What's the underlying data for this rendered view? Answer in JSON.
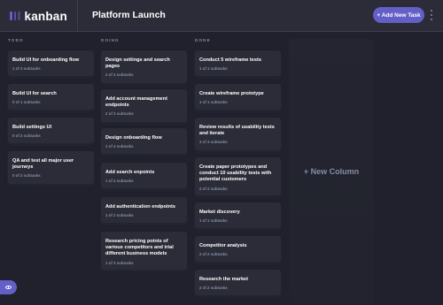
{
  "app": {
    "name": "kanban"
  },
  "header": {
    "board_title": "Platform Launch",
    "add_task_label": "+ Add New Task"
  },
  "columns": [
    {
      "name": "TODO",
      "tasks": [
        {
          "title": "Build UI for onboarding flow",
          "subtasks": "1 of 3 subtasks"
        },
        {
          "title": "Build UI for search",
          "subtasks": "0 of 1 subtasks"
        },
        {
          "title": "Build settings UI",
          "subtasks": "0 of 2 subtasks"
        },
        {
          "title": "QA and test all major user journeys",
          "subtasks": "0 of 2 subtasks"
        }
      ]
    },
    {
      "name": "DOING",
      "tasks": [
        {
          "title": "Design settings and search pages",
          "subtasks": "2 of 3 subtasks"
        },
        {
          "title": "Add account management endpoints",
          "subtasks": "2 of 3 subtasks"
        },
        {
          "title": "Design onboarding flow",
          "subtasks": "1 of 3 subtasks"
        },
        {
          "title": "Add search enpoints",
          "subtasks": "1 of 2 subtasks"
        },
        {
          "title": "Add authentication endpoints",
          "subtasks": "1 of 2 subtasks"
        },
        {
          "title": "Research pricing points of various competitors and trial different business models",
          "subtasks": "1 of 3 subtasks"
        }
      ]
    },
    {
      "name": "DONE",
      "tasks": [
        {
          "title": "Conduct 5 wireframe tests",
          "subtasks": "1 of 1 subtasks"
        },
        {
          "title": "Create wireframe prototype",
          "subtasks": "1 of 1 subtasks"
        },
        {
          "title": "Review results of usability tests and iterate",
          "subtasks": "3 of 3 subtasks"
        },
        {
          "title": "Create paper prototypes and conduct 10 usability tests with potential customers",
          "subtasks": "2 of 2 subtasks"
        },
        {
          "title": "Market discovery",
          "subtasks": "1 of 1 subtasks"
        },
        {
          "title": "Competitor analysis",
          "subtasks": "2 of 2 subtasks"
        },
        {
          "title": "Research the market",
          "subtasks": "2 of 2 subtasks"
        }
      ]
    }
  ],
  "new_column_label": "+ New Column",
  "icons": {
    "logo": "kanban-logo-icon",
    "menu": "vertical-ellipsis-icon",
    "sidebar": "eye-icon"
  },
  "colors": {
    "accent": "#635fc7",
    "background": "#20212c",
    "card": "#2b2c37",
    "muted": "#828fa3"
  }
}
